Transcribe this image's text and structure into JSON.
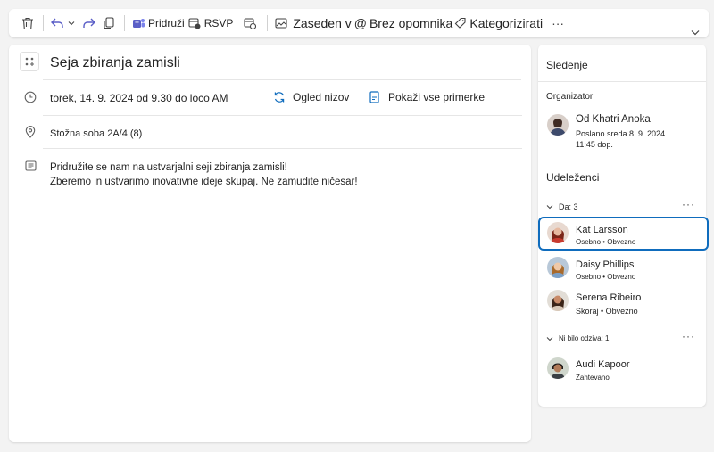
{
  "toolbar": {
    "join_label": "Pridruži",
    "rsvp_label": "RSVP",
    "busy_label": "Zaseden v",
    "reminder_label": "Brez opomnika",
    "categorize_label": "Kategorizirati",
    "more_label": "···"
  },
  "event": {
    "title": "Seja zbiranja zamisli",
    "datetime": "torek, 14. 9. 2024 od 9.30 do loco AM",
    "series_label": "Ogled nizov",
    "instances_label": "Pokaži vse primerke",
    "location": "Stožna soba 2A/4 (8)",
    "body_line1": "Pridružite se nam na ustvarjalni seji zbiranja zamisli!",
    "body_line2": "Zberemo in ustvarimo inovativne ideje skupaj. Ne zamudite ničesar!"
  },
  "tracking": {
    "title": "Sledenje",
    "organizer_heading": "Organizator",
    "organizer_name": "Od Khatri Anoka",
    "organizer_sent_line1": "Poslano sreda 8. 9. 2024.",
    "organizer_sent_line2": "11:45 dop.",
    "attendees_heading": "Udeleženci",
    "yes_group": "Da: 3",
    "no_response_group": "Ni bilo odziva: 1",
    "attendees": [
      {
        "name": "Kat Larsson",
        "sub": "Osebno • Obvezno"
      },
      {
        "name": "Daisy Phillips",
        "sub": "Osebno • Obvezno"
      },
      {
        "name": "Serena Ribeiro",
        "sub": "Skoraj • Obvezno"
      }
    ],
    "no_response": [
      {
        "name": "Audi Kapoor",
        "sub": "Zahtevano"
      }
    ]
  },
  "colors": {
    "accent": "#0f6cbd",
    "teams_purple": "#5b5fc7"
  }
}
